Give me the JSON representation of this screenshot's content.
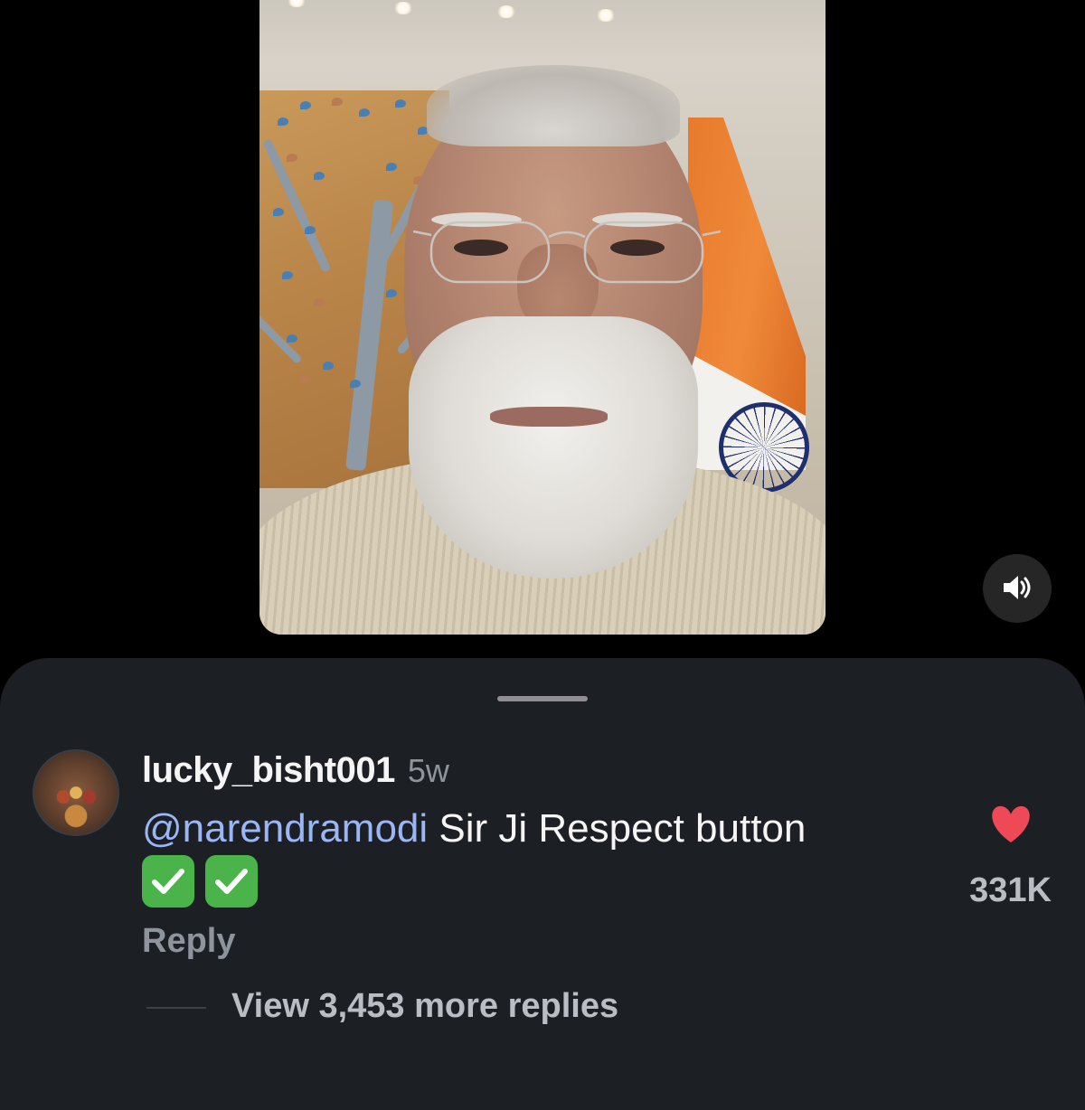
{
  "video": {
    "description_icon": "person-video",
    "sound_icon": "speaker-volume-icon"
  },
  "comment": {
    "username": "lucky_bisht001",
    "time_ago": "5w",
    "mention": "@narendramodi",
    "text": "Sir Ji Respect button",
    "emoji": [
      "✅",
      "✅"
    ],
    "reply_label": "Reply",
    "like_icon": "heart-icon",
    "like_color": "#ed4956",
    "like_count": "331K",
    "view_replies_label": "View 3,453 more replies"
  },
  "colors": {
    "sheet_background": "#1c1f24",
    "mention": "#9ab6f5",
    "secondary_text": "#8e949c"
  }
}
